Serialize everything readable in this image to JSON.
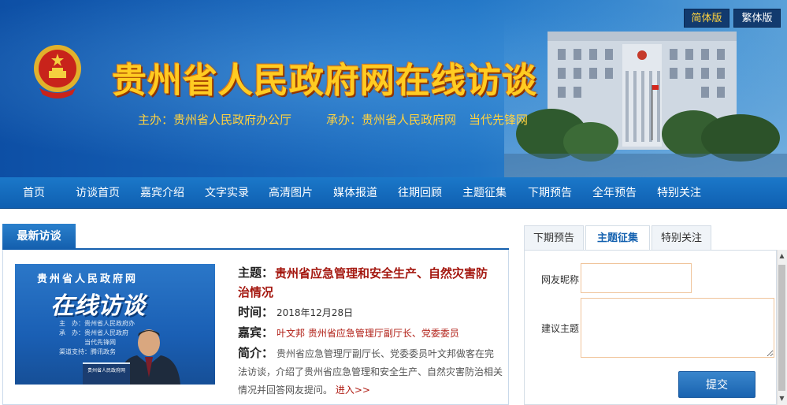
{
  "header": {
    "title": "贵州省人民政府网在线访谈",
    "sponsor_host": "主办：贵州省人民政府办公厅",
    "sponsor_org": "承办：贵州省人民政府网",
    "sponsor_partner": "当代先锋网",
    "lang_simplified": "简体版",
    "lang_traditional": "繁体版"
  },
  "nav": {
    "items": [
      "首页",
      "访谈首页",
      "嘉宾介绍",
      "文字实录",
      "高清图片",
      "媒体报道",
      "往期回顾",
      "主题征集",
      "下期预告",
      "全年预告",
      "特别关注"
    ]
  },
  "latest": {
    "section_title": "最新访谈",
    "thumbnail": {
      "header": "贵州省人民政府网",
      "logo": "在线访谈",
      "info_lines": [
        "主　办：贵州省人民政府办",
        "承　办：贵州省人民政府",
        "　　　　当代先锋网",
        "渠道支持：腾讯政务"
      ],
      "desk_label": "贵州省人民政府网"
    },
    "topic_label": "主题：",
    "topic_line1": "贵州省应急管理和安全生产、自然灾害防",
    "topic_line2": "治情况",
    "time_label": "时间：",
    "time": "2018年12月28日",
    "guest_label": "嘉宾：",
    "guest": "叶文邦 贵州省应急管理厅副厅长、党委委员",
    "intro_label": "简介：",
    "intro": "贵州省应急管理厅副厅长、党委委员叶文邦做客在完法访谈，介绍了贵州省应急管理和安全生产、自然灾害防治相关情况并回答网友提问。",
    "read_more": "进入>>"
  },
  "sidebar": {
    "tabs": [
      "下期预告",
      "主题征集",
      "特别关注"
    ],
    "active_tab": "主题征集",
    "form": {
      "nickname_label": "网友昵称",
      "nickname_value": "",
      "topic_label": "建议主题",
      "topic_value": "",
      "submit_label": "提交"
    }
  },
  "colors": {
    "banner_blue": "#1763b8",
    "title_gold": "#ffcc22",
    "nav_blue": "#0f5fb1",
    "topic_red": "#a4170f"
  }
}
